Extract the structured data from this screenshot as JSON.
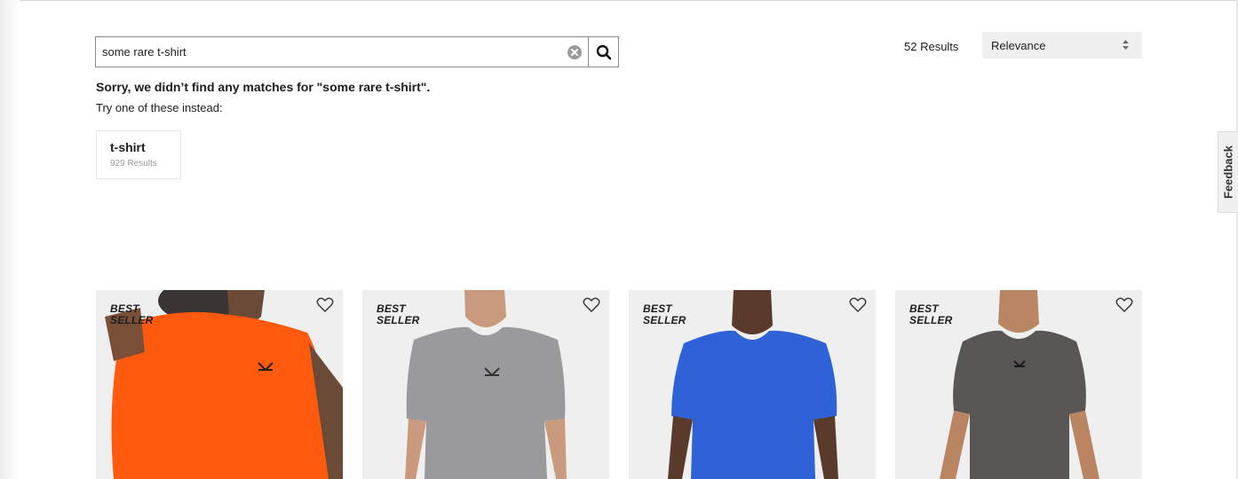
{
  "search": {
    "value": "some rare t-shirt",
    "clear_icon": "circle-x-icon",
    "submit_icon": "magnifier-icon"
  },
  "no_results": {
    "message": "Sorry, we didn’t find any matches for \"some rare t-shirt\".",
    "try_text": "Try one of these instead:"
  },
  "suggestion": {
    "term": "t-shirt",
    "count": "929 Results"
  },
  "results": {
    "count": "52 Results",
    "sort_selected": "Relevance"
  },
  "feedback": {
    "label": "Feedback"
  },
  "products": [
    {
      "badge_line1": "BEST",
      "badge_line2": "SELLER",
      "shirt_color": "#ff5a0e"
    },
    {
      "badge_line1": "BEST",
      "badge_line2": "SELLER",
      "shirt_color": "#9a9a9c"
    },
    {
      "badge_line1": "BEST",
      "badge_line2": "SELLER",
      "shirt_color": "#2f62d6"
    },
    {
      "badge_line1": "BEST",
      "badge_line2": "SELLER",
      "shirt_color": "#595755"
    }
  ],
  "colors": {
    "card_background": "#efefef",
    "sort_background": "#f0f0f0",
    "text": "#1d1d1d",
    "muted": "#9a9a9a"
  }
}
